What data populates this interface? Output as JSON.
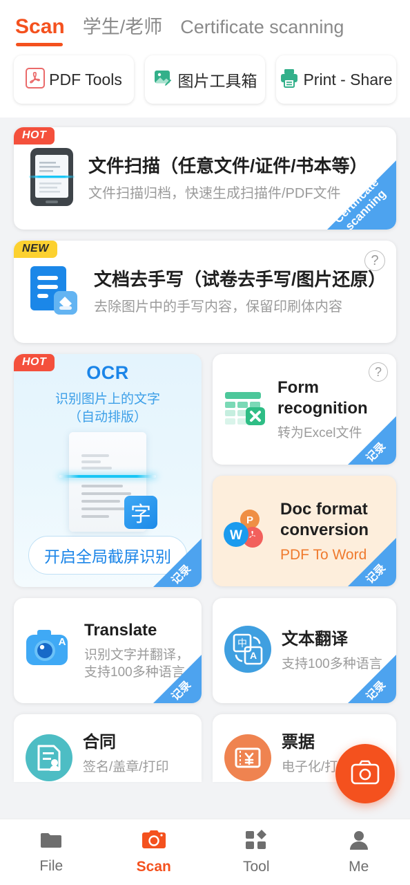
{
  "header": {
    "tabs": [
      {
        "label": "Scan",
        "active": true
      },
      {
        "label": "学生/老师",
        "active": false
      },
      {
        "label": "Certificate scanning",
        "active": false
      }
    ]
  },
  "quick_tools": [
    {
      "label": "PDF Tools",
      "icon": "pdf-icon",
      "color": "#ea6a6a"
    },
    {
      "label": "图片工具箱",
      "icon": "image-edit-icon",
      "color": "#33b08a"
    },
    {
      "label": "Print - Share",
      "icon": "printer-icon",
      "color": "#33b08a"
    }
  ],
  "cards": {
    "doc_scan": {
      "badge": "HOT",
      "title": "文件扫描（任意文件/证件/书本等）",
      "subtitle": "文件扫描归档，快速生成扫描件/PDF文件",
      "ribbon": "Certificate scanning",
      "icon": "phone-scan-icon"
    },
    "remove_handwriting": {
      "badge": "NEW",
      "title": "文档去手写（试卷去手写/图片还原）",
      "subtitle": "去除图片中的手写内容，保留印刷体内容",
      "help": "?",
      "icon": "document-eraser-icon"
    },
    "ocr": {
      "badge": "HOT",
      "title": "OCR",
      "subtitle_line1": "识别图片上的文字",
      "subtitle_line2": "（自动排版）",
      "art_label": "字",
      "button": "开启全局截屏识别",
      "ribbon": "记录"
    },
    "form_recognition": {
      "title": "Form recognition",
      "subtitle": "转为Excel文件",
      "help": "?",
      "ribbon": "记录",
      "icon": "table-excel-icon"
    },
    "doc_conversion": {
      "title": "Doc format conversion",
      "subtitle": "PDF To Word",
      "ribbon": "记录",
      "icon": "word-ppt-pdf-icon"
    },
    "translate": {
      "title": "Translate",
      "subtitle": "识别文字并翻译，支持100多种语言",
      "ribbon": "记录",
      "icon": "camera-translate-icon"
    },
    "text_translate": {
      "title": "文本翻译",
      "subtitle": "支持100多种语言",
      "ribbon": "记录",
      "icon": "language-translate-icon"
    },
    "contract": {
      "title": "合同",
      "subtitle": "签名/盖章/打印",
      "icon": "contract-sign-icon"
    },
    "invoice": {
      "title": "票据",
      "subtitle": "电子化/打印/分享",
      "icon": "receipt-yen-icon"
    }
  },
  "fab": {
    "icon": "camera-icon"
  },
  "bottom_nav": [
    {
      "label": "File",
      "icon": "folder-icon",
      "active": false
    },
    {
      "label": "Scan",
      "icon": "camera-icon",
      "active": true
    },
    {
      "label": "Tool",
      "icon": "grid-tool-icon",
      "active": false
    },
    {
      "label": "Me",
      "icon": "person-icon",
      "active": false
    }
  ],
  "colors": {
    "accent": "#f4511e",
    "ribbon_blue": "#4da3ef",
    "hot_red": "#f4503c",
    "new_yellow": "#fcd130"
  }
}
